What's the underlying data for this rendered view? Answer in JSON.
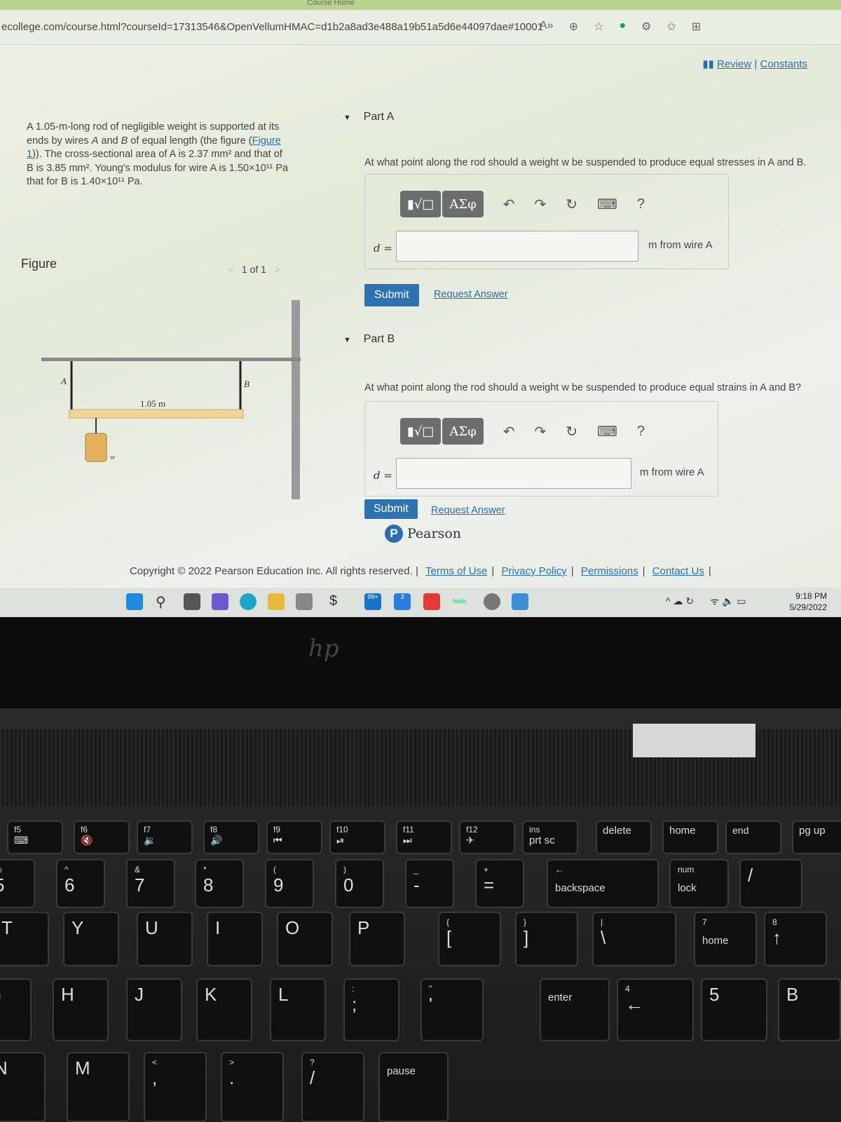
{
  "browser": {
    "tab_title": "Course Home",
    "url": "ecollege.com/course.html?courseId=17313546&OpenVellumHMAC=d1b2a8ad3e488a19b51a5d6e44097dae#10001"
  },
  "top_links": {
    "review": "Review",
    "separator": "|",
    "constants": "Constants"
  },
  "problem": {
    "text_1": "A 1.05-m-long rod of negligible weight is supported at its ends by wires ",
    "A": "A",
    "text_2": " and ",
    "B": "B",
    "text_3": " of equal length (the figure (",
    "figure_link": "Figure 1",
    "text_4": ")). The cross-sectional area of A is 2.37 mm² and that of B is 3.85 mm². Young's modulus for wire A is 1.50×10¹¹ Pa that for B is 1.40×10¹¹ Pa."
  },
  "figure": {
    "heading": "Figure",
    "pager": "1 of 1",
    "label_a": "A",
    "label_b": "B",
    "length": "1.05 m",
    "weight": "w"
  },
  "parts": [
    {
      "title": "Part A",
      "question": "At what point along the rod should a weight w be suspended to produce equal stresses in A and B.",
      "var": "d =",
      "value": "",
      "unit": "m from wire A",
      "submit": "Submit",
      "request": "Request Answer"
    },
    {
      "title": "Part B",
      "question": "At what point along the rod should a weight w be suspended to produce equal strains in A and B?",
      "var": "d =",
      "value": "",
      "unit": "m from wire A",
      "submit": "Submit",
      "request": "Request Answer"
    }
  ],
  "toolbar": {
    "templates": "▮√□",
    "symbols": "ΑΣφ",
    "undo": "↶",
    "redo": "↷",
    "reset": "↻",
    "keyboard": "⌨",
    "help": "?"
  },
  "brand": {
    "logo_letter": "P",
    "name": "Pearson"
  },
  "footer": {
    "copyright": "Copyright © 2022 Pearson Education Inc. All rights reserved.",
    "links": [
      "Terms of Use",
      "Privacy Policy",
      "Permissions",
      "Contact Us"
    ]
  },
  "taskbar": {
    "badge_mail": "99+",
    "badge_other": "3",
    "hulu": "hulu",
    "time": "9:18 PM",
    "date": "5/29/2022"
  },
  "laptop": {
    "logo": "hp"
  },
  "keys": [
    [
      "f5",
      "⌨"
    ],
    [
      "f6",
      "🔇"
    ],
    [
      "f7",
      "🔉"
    ],
    [
      "f8",
      "🔊"
    ],
    [
      "f9",
      "⏮"
    ],
    [
      "f10",
      "⏯"
    ],
    [
      "f11",
      "⏭"
    ],
    [
      "f12",
      "✈"
    ],
    [
      "ins",
      "prt sc"
    ],
    [
      "",
      "delete"
    ],
    [
      "",
      "home"
    ],
    [
      "",
      "end"
    ],
    [
      "",
      "pg up"
    ],
    [
      "%",
      "5"
    ],
    [
      "^",
      "6"
    ],
    [
      "&",
      "7"
    ],
    [
      "*",
      "8"
    ],
    [
      "(",
      "9"
    ],
    [
      ")",
      "0"
    ],
    [
      "_",
      "-"
    ],
    [
      "+",
      "="
    ],
    [
      "←",
      "backspace"
    ],
    [
      "num",
      "lock"
    ],
    [
      "",
      "/"
    ],
    [
      "",
      "T"
    ],
    [
      "",
      "Y"
    ],
    [
      "",
      "U"
    ],
    [
      "",
      "I"
    ],
    [
      "",
      "O"
    ],
    [
      "",
      "P"
    ],
    [
      "{",
      "["
    ],
    [
      "}",
      "]"
    ],
    [
      "|",
      "\\"
    ],
    [
      "7",
      "home"
    ],
    [
      "8",
      "↑"
    ],
    [
      "",
      "G"
    ],
    [
      "",
      "H"
    ],
    [
      "",
      "J"
    ],
    [
      "",
      "K"
    ],
    [
      "",
      "L"
    ],
    [
      ":",
      ";"
    ],
    [
      "\"",
      "'"
    ],
    [
      "↵",
      ""
    ],
    [
      "",
      "enter"
    ],
    [
      "4",
      "←"
    ],
    [
      "",
      "5"
    ],
    [
      "",
      "B"
    ],
    [
      "",
      "N"
    ],
    [
      "",
      "M"
    ],
    [
      "<",
      ","
    ],
    [
      ">",
      "."
    ],
    [
      "?",
      "/"
    ],
    [
      "",
      "pause"
    ]
  ],
  "colors": {
    "accent": "#2e73b0",
    "link": "#2a6db0"
  }
}
